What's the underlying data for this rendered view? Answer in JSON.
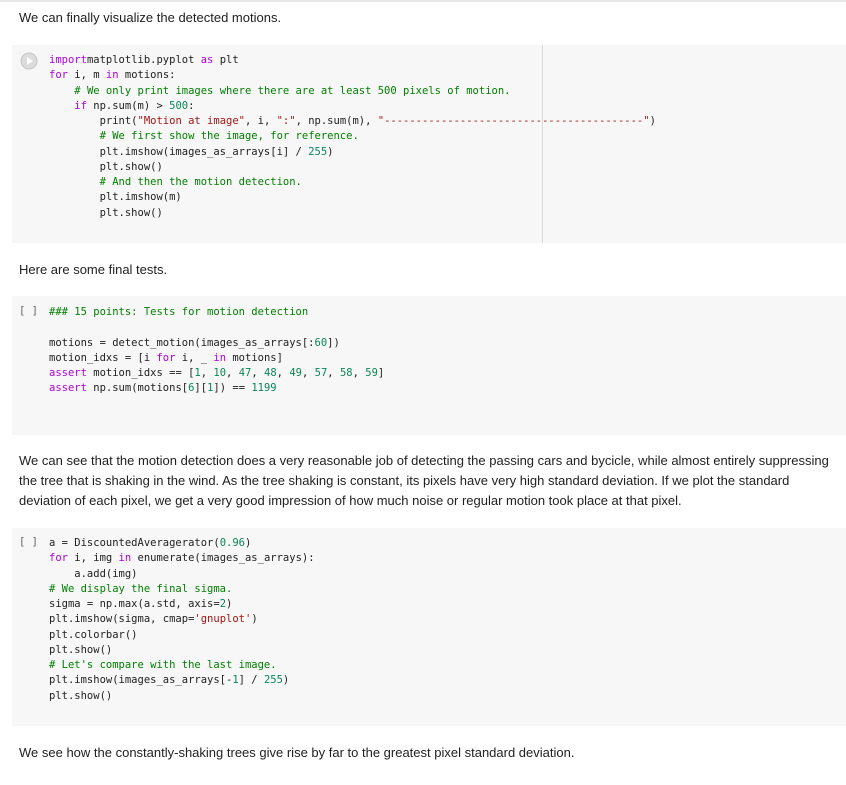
{
  "cells": [
    {
      "type": "text",
      "text": "We can finally visualize the detected motions."
    },
    {
      "type": "code",
      "run_icon": "play-icon"
    },
    {
      "type": "text",
      "text": "Here are some final tests."
    },
    {
      "type": "code",
      "bracket": "[ ]"
    },
    {
      "type": "text",
      "text": "We can see that the motion detection does a very reasonable job of detecting the passing cars and bycicle, while almost entirely suppressing the tree that is shaking in the wind. As the tree shaking is constant, its pixels have very high standard deviation. If we plot the standard deviation of each pixel, we get a very good impression of how much noise or regular motion took place at that pixel."
    },
    {
      "type": "code",
      "bracket": "[ ]"
    },
    {
      "type": "text",
      "text": "We see how the constantly-shaking trees give rise by far to the greatest pixel standard deviation."
    }
  ],
  "code1": [
    [
      [
        "kw2",
        "import"
      ],
      [
        "",
        "matplotlib.pyplot "
      ],
      [
        "kw2",
        "as"
      ],
      [
        "",
        " plt"
      ]
    ],
    [
      [
        "kw2",
        "for"
      ],
      [
        "",
        " i, m "
      ],
      [
        "kw2",
        "in"
      ],
      [
        "",
        " motions:"
      ]
    ],
    [
      [
        "",
        "    "
      ],
      [
        "cm",
        "# We only print images where there are at least 500 pixels of motion."
      ]
    ],
    [
      [
        "",
        "    "
      ],
      [
        "kw2",
        "if"
      ],
      [
        "",
        " np.sum(m) > "
      ],
      [
        "num",
        "500"
      ],
      [
        "",
        ":"
      ]
    ],
    [
      [
        "",
        "        print("
      ],
      [
        "str",
        "\"Motion at image\""
      ],
      [
        "",
        ", i, "
      ],
      [
        "str",
        "\":\""
      ],
      [
        "",
        ", np.sum(m), "
      ],
      [
        "str",
        "\"-----------------------------------------\""
      ],
      [
        "",
        ")"
      ]
    ],
    [
      [
        "",
        "        "
      ],
      [
        "cm",
        "# We first show the image, for reference."
      ]
    ],
    [
      [
        "",
        "        plt.imshow(images_as_arrays[i] / "
      ],
      [
        "num",
        "255"
      ],
      [
        "",
        ")"
      ]
    ],
    [
      [
        "",
        "        plt.show()"
      ]
    ],
    [
      [
        "",
        "        "
      ],
      [
        "cm",
        "# And then the motion detection."
      ]
    ],
    [
      [
        "",
        "        plt.imshow(m)"
      ]
    ],
    [
      [
        "",
        "        plt.show()"
      ]
    ]
  ],
  "code2": [
    [
      [
        "cm",
        "### 15 points: Tests for motion detection"
      ]
    ],
    [
      [
        "",
        ""
      ]
    ],
    [
      [
        "",
        "motions = detect_motion(images_as_arrays[:"
      ],
      [
        "num",
        "60"
      ],
      [
        "",
        "])"
      ]
    ],
    [
      [
        "",
        "motion_idxs = [i "
      ],
      [
        "kw2",
        "for"
      ],
      [
        "",
        " i, _ "
      ],
      [
        "kw2",
        "in"
      ],
      [
        "",
        " motions]"
      ]
    ],
    [
      [
        "kw2",
        "assert"
      ],
      [
        "",
        " motion_idxs == ["
      ],
      [
        "num",
        "1"
      ],
      [
        "",
        ", "
      ],
      [
        "num",
        "10"
      ],
      [
        "",
        ", "
      ],
      [
        "num",
        "47"
      ],
      [
        "",
        ", "
      ],
      [
        "num",
        "48"
      ],
      [
        "",
        ", "
      ],
      [
        "num",
        "49"
      ],
      [
        "",
        ", "
      ],
      [
        "num",
        "57"
      ],
      [
        "",
        ", "
      ],
      [
        "num",
        "58"
      ],
      [
        "",
        ", "
      ],
      [
        "num",
        "59"
      ],
      [
        "",
        "]"
      ]
    ],
    [
      [
        "kw2",
        "assert"
      ],
      [
        "",
        " np.sum(motions["
      ],
      [
        "num",
        "6"
      ],
      [
        "",
        "]["
      ],
      [
        "num",
        "1"
      ],
      [
        "",
        "]) == "
      ],
      [
        "num",
        "1199"
      ]
    ]
  ],
  "code3": [
    [
      [
        "",
        "a = DiscountedAveragerator("
      ],
      [
        "num",
        "0.96"
      ],
      [
        "",
        ")"
      ]
    ],
    [
      [
        "kw2",
        "for"
      ],
      [
        "",
        " i, img "
      ],
      [
        "kw2",
        "in"
      ],
      [
        "",
        " enumerate(images_as_arrays):"
      ]
    ],
    [
      [
        "",
        "    a.add(img)"
      ]
    ],
    [
      [
        "cm",
        "# We display the final sigma."
      ]
    ],
    [
      [
        "",
        "sigma = np.max(a.std, axis="
      ],
      [
        "num",
        "2"
      ],
      [
        "",
        ")"
      ]
    ],
    [
      [
        "",
        "plt.imshow(sigma, cmap="
      ],
      [
        "str",
        "'gnuplot'"
      ],
      [
        "",
        ")"
      ]
    ],
    [
      [
        "",
        "plt.colorbar()"
      ]
    ],
    [
      [
        "",
        "plt.show()"
      ]
    ],
    [
      [
        "cm",
        "# Let's compare with the last image."
      ]
    ],
    [
      [
        "",
        "plt.imshow(images_as_arrays[-"
      ],
      [
        "num",
        "1"
      ],
      [
        "",
        "] / "
      ],
      [
        "num",
        "255"
      ],
      [
        "",
        ")"
      ]
    ],
    [
      [
        "",
        "plt.show()"
      ]
    ]
  ]
}
